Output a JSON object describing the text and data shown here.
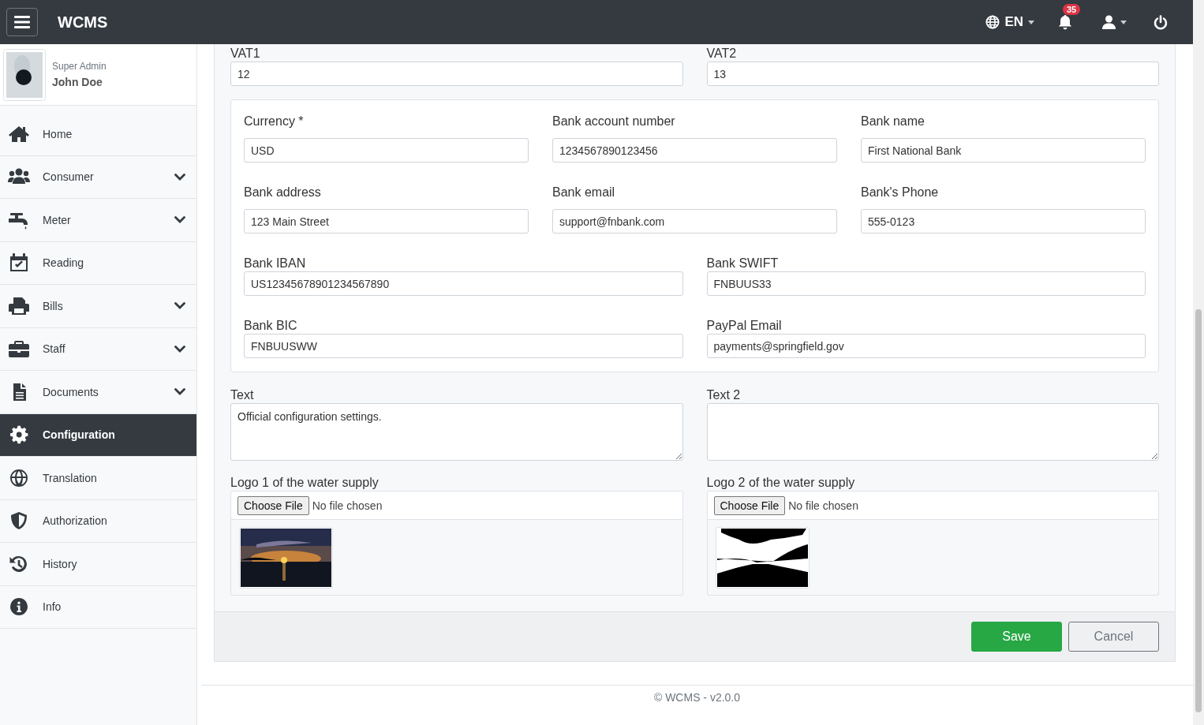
{
  "header": {
    "brand": "WCMS",
    "language": "EN",
    "notification_count": "35"
  },
  "user": {
    "role": "Super Admin",
    "name": "John Doe"
  },
  "sidebar": {
    "items": [
      {
        "label": "Home",
        "has_submenu": false,
        "selected": false
      },
      {
        "label": "Consumer",
        "has_submenu": true,
        "selected": false
      },
      {
        "label": "Meter",
        "has_submenu": true,
        "selected": false
      },
      {
        "label": "Reading",
        "has_submenu": false,
        "selected": false
      },
      {
        "label": "Bills",
        "has_submenu": true,
        "selected": false
      },
      {
        "label": "Staff",
        "has_submenu": true,
        "selected": false
      },
      {
        "label": "Documents",
        "has_submenu": true,
        "selected": false
      },
      {
        "label": "Configuration",
        "has_submenu": false,
        "selected": true
      },
      {
        "label": "Translation",
        "has_submenu": false,
        "selected": false
      },
      {
        "label": "Authorization",
        "has_submenu": false,
        "selected": false
      },
      {
        "label": "History",
        "has_submenu": false,
        "selected": false
      },
      {
        "label": "Info",
        "has_submenu": false,
        "selected": false
      }
    ]
  },
  "vat_fields": [
    {
      "label": "VAT1",
      "value": "12"
    },
    {
      "label": "VAT2",
      "value": "13"
    }
  ],
  "bank_panel": {
    "rows": [
      [
        {
          "label": "Currency *",
          "value": "USD"
        },
        {
          "label": "Bank account number",
          "value": "1234567890123456"
        },
        {
          "label": "Bank name",
          "value": "First National Bank"
        }
      ],
      [
        {
          "label": "Bank address",
          "value": "123 Main Street"
        },
        {
          "label": "Bank email",
          "value": "support@fnbank.com"
        },
        {
          "label": "Bank's Phone",
          "value": "555-0123"
        }
      ],
      [
        {
          "label": "Bank IBAN",
          "value": "US12345678901234567890"
        },
        {
          "label": "Bank SWIFT",
          "value": "FNBUUS33"
        }
      ],
      [
        {
          "label": "Bank BIC",
          "value": "FNBUUSWW"
        },
        {
          "label": "PayPal Email",
          "value": "payments@springfield.gov"
        }
      ]
    ]
  },
  "text_areas": [
    {
      "label": "Text",
      "value": "Official configuration settings."
    },
    {
      "label": "Text 2"
    }
  ],
  "logos": [
    {
      "label": "Logo 1 of the water supply",
      "button": "Choose File",
      "status": "No file chosen"
    },
    {
      "label": "Logo 2 of the water supply",
      "button": "Choose File",
      "status": "No file chosen"
    }
  ],
  "actions": {
    "save": "Save",
    "cancel": "Cancel"
  },
  "footer": "© WCMS - v2.0.0"
}
